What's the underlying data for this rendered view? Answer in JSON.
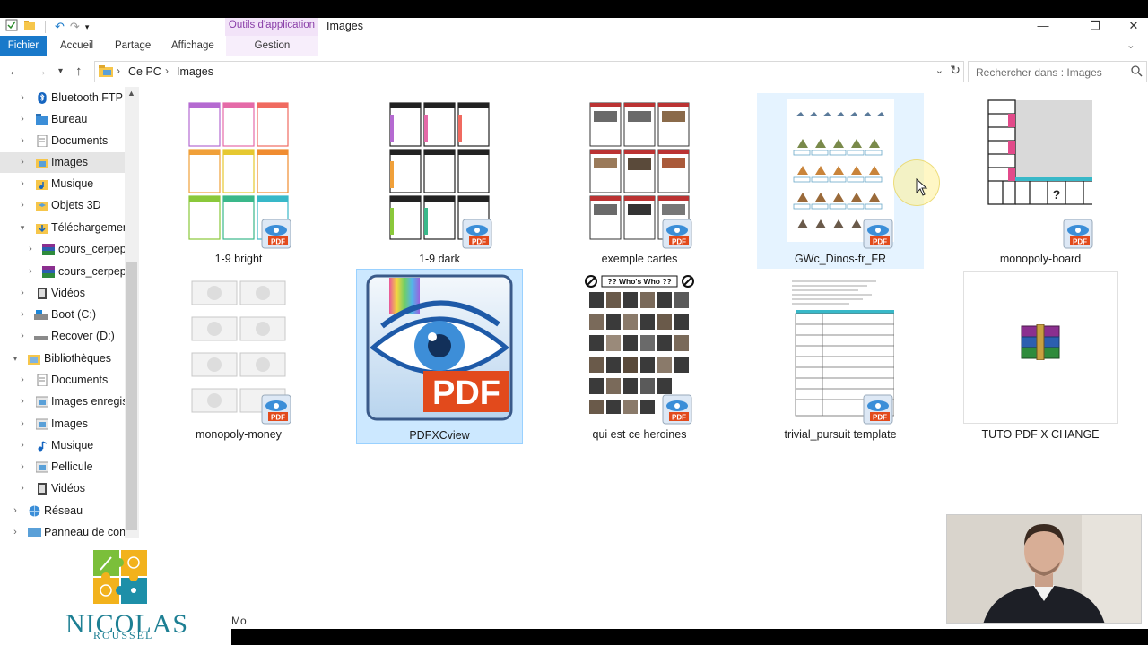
{
  "window": {
    "tools_tab": "Outils d'application",
    "title": "Images"
  },
  "ribbon": {
    "tabs": [
      "Fichier",
      "Accueil",
      "Partage",
      "Affichage",
      "Gestion"
    ]
  },
  "address": {
    "crumbs": [
      "Ce PC",
      "Images"
    ],
    "search_placeholder": "Rechercher dans : Images"
  },
  "sidebar": {
    "items": [
      {
        "label": "Bluetooth FTP",
        "icon": "bluetooth-icon"
      },
      {
        "label": "Bureau",
        "icon": "desktop-folder-icon"
      },
      {
        "label": "Documents",
        "icon": "documents-folder-icon"
      },
      {
        "label": "Images",
        "icon": "pictures-folder-icon",
        "selected": true
      },
      {
        "label": "Musique",
        "icon": "music-folder-icon"
      },
      {
        "label": "Objets 3D",
        "icon": "3d-objects-folder-icon"
      },
      {
        "label": "Téléchargement",
        "icon": "downloads-folder-icon"
      },
      {
        "label": "cours_cerpep_",
        "icon": "winrar-archive-icon"
      },
      {
        "label": "cours_cerpep_",
        "icon": "winrar-archive-icon"
      },
      {
        "label": "Vidéos",
        "icon": "videos-folder-icon"
      },
      {
        "label": "Boot (C:)",
        "icon": "drive-icon"
      },
      {
        "label": "Recover (D:)",
        "icon": "drive-icon"
      },
      {
        "label": "Bibliothèques",
        "icon": "libraries-icon"
      },
      {
        "label": "Documents",
        "icon": "documents-folder-icon"
      },
      {
        "label": "Images enregis",
        "icon": "pictures-folder-icon"
      },
      {
        "label": "Images",
        "icon": "pictures-folder-icon"
      },
      {
        "label": "Musique",
        "icon": "music-folder-icon"
      },
      {
        "label": "Pellicule",
        "icon": "pictures-folder-icon"
      },
      {
        "label": "Vidéos",
        "icon": "videos-folder-icon"
      },
      {
        "label": "Réseau",
        "icon": "network-icon"
      },
      {
        "label": "Panneau de conf",
        "icon": "control-panel-icon"
      }
    ]
  },
  "files": [
    {
      "name": "1-9 bright"
    },
    {
      "name": "1-9 dark"
    },
    {
      "name": "exemple cartes"
    },
    {
      "name": "GWc_Dinos-fr_FR"
    },
    {
      "name": "monopoly-board"
    },
    {
      "name": "monopoly-money"
    },
    {
      "name": "PDFXCview"
    },
    {
      "name": "qui est ce heroines",
      "thumb_text": "?? Who's Who ??"
    },
    {
      "name": "trivial_pursuit template"
    },
    {
      "name": "TUTO PDF X CHANGE"
    }
  ],
  "thumbs": {
    "pdf_logo_text": "PDF",
    "board_mark": "?"
  },
  "status": {
    "text": "Mo"
  },
  "branding": {
    "name": "NICOLAS",
    "sub": "ROUSSEL"
  },
  "colors": {
    "accent": "#1979ca",
    "selection": "#cce8ff",
    "tools_tab": "#8a3fa8",
    "logo": "#1d7f93"
  }
}
